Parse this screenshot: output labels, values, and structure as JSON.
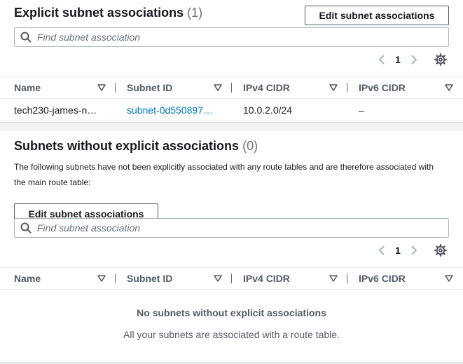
{
  "explicit": {
    "title": "Explicit subnet associations",
    "count": "(1)",
    "edit_button": "Edit subnet associations",
    "search_placeholder": "Find subnet association",
    "page": "1",
    "columns": [
      "Name",
      "Subnet ID",
      "IPv4 CIDR",
      "IPv6 CIDR"
    ],
    "rows": [
      {
        "name": "tech230-james-n…",
        "subnet_id": "subnet-0d550897…",
        "ipv4": "10.0.2.0/24",
        "ipv6": "–"
      }
    ]
  },
  "without": {
    "title": "Subnets without explicit associations",
    "count": "(0)",
    "description": "The following subnets have not been explicitly associated with any route tables and are therefore associated with the main route table:",
    "edit_button": "Edit subnet associations",
    "search_placeholder": "Find subnet association",
    "page": "1",
    "columns": [
      "Name",
      "Subnet ID",
      "IPv4 CIDR",
      "IPv6 CIDR"
    ],
    "empty_title": "No subnets without explicit associations",
    "empty_subtitle": "All your subnets are associated with a route table."
  },
  "icons": {
    "search": "search-icon",
    "prev": "chevron-left-icon",
    "next": "chevron-right-icon",
    "settings": "gear-icon",
    "sort": "sort-down-icon"
  },
  "colors": {
    "link": "#0073bb",
    "text": "#16191f",
    "muted": "#687078",
    "border": "#aab7b8"
  }
}
